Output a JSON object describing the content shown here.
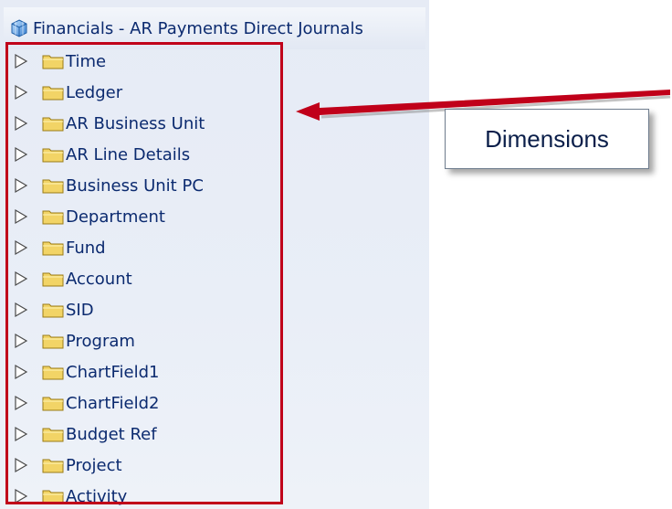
{
  "header": {
    "title": "Financials - AR Payments Direct Journals",
    "icon": "subject-area-cube-icon"
  },
  "tree": {
    "items": [
      {
        "label": "Time"
      },
      {
        "label": "Ledger"
      },
      {
        "label": "AR Business Unit"
      },
      {
        "label": "AR Line Details"
      },
      {
        "label": "Business Unit PC"
      },
      {
        "label": "Department"
      },
      {
        "label": "Fund"
      },
      {
        "label": "Account"
      },
      {
        "label": "SID"
      },
      {
        "label": "Program"
      },
      {
        "label": "ChartField1"
      },
      {
        "label": "ChartField2"
      },
      {
        "label": "Budget Ref"
      },
      {
        "label": "Project"
      },
      {
        "label": "Activity"
      }
    ]
  },
  "callout": {
    "text": "Dimensions"
  },
  "colors": {
    "highlight": "#c0001a",
    "text": "#0b2a6f",
    "folder": "#f2d466"
  }
}
